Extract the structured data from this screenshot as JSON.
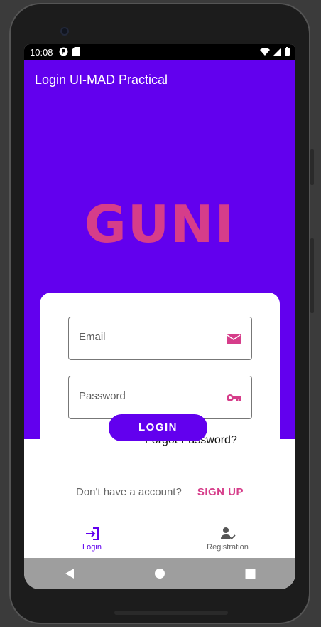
{
  "status_bar": {
    "time": "10:08"
  },
  "app_bar": {
    "title": "Login UI-MAD Practical"
  },
  "hero": {
    "logo_text": "GUNI"
  },
  "login_form": {
    "email_placeholder": "Email",
    "password_placeholder": "Password",
    "forgot_password": "Forgot Password?",
    "login_button": "LOGIN"
  },
  "signup": {
    "prompt": "Don't have a account?",
    "link": "SIGN UP"
  },
  "bottom_nav": {
    "items": [
      {
        "label": "Login",
        "icon": "login-icon",
        "active": true
      },
      {
        "label": "Registration",
        "icon": "person-check-icon",
        "active": false
      }
    ]
  },
  "colors": {
    "primary": "#6200ee",
    "accent": "#d63d8a"
  }
}
